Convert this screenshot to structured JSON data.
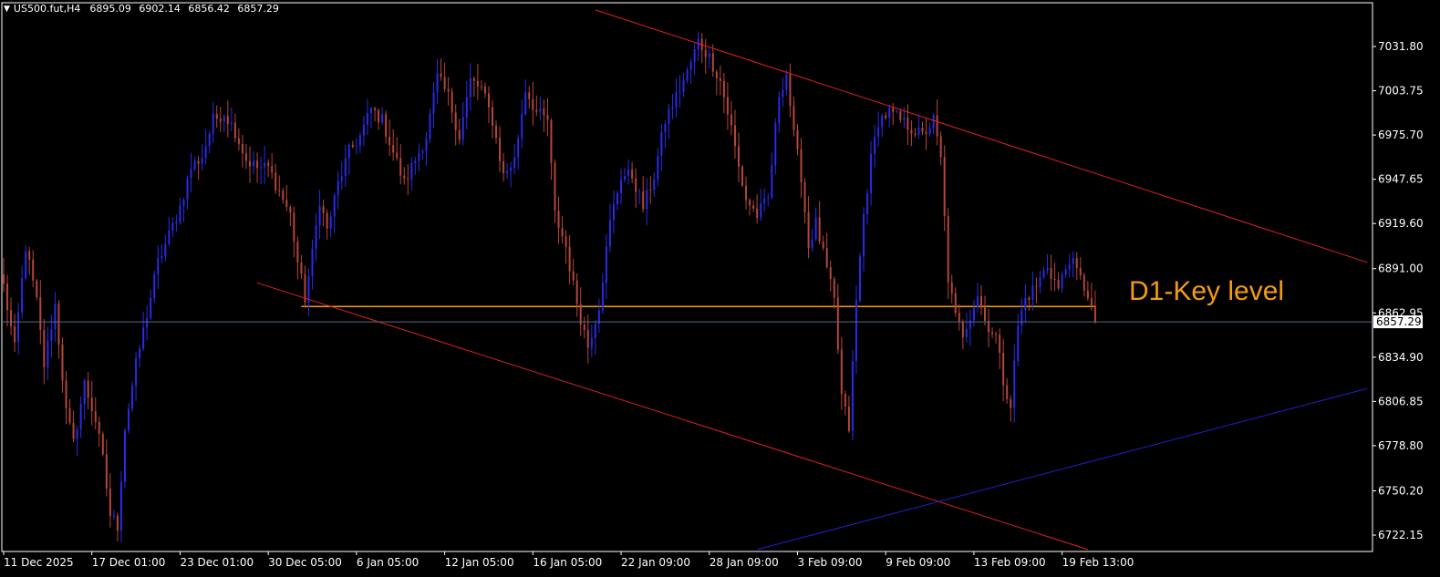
{
  "header": {
    "symbol": "US500.fut,H4",
    "open": "6895.09",
    "high": "6902.14",
    "low": "6856.42",
    "close": "6857.29"
  },
  "annotation": {
    "text": "D1-Key level",
    "color": "#f39c12"
  },
  "colors": {
    "background": "#000000",
    "frame": "#ffffff",
    "bull_candle": "#2a2ae8",
    "bear_candle": "#b5463a",
    "channel_line": "#e02020",
    "support_line": "#2020d0",
    "key_level": "#f39c12",
    "current_price_line": "#5a6b86"
  },
  "chart_data": {
    "type": "candlestick",
    "title": "US500.fut,H4",
    "ylim": [
      6710,
      7051
    ],
    "grid": false,
    "y_ticks": [
      "7031.80",
      "7003.75",
      "6975.70",
      "6947.65",
      "6919.60",
      "6891.00",
      "6862.95",
      "6834.90",
      "6806.85",
      "6778.80",
      "6750.20",
      "6722.15"
    ],
    "x_ticks": [
      {
        "label": "11 Dec 2025",
        "index": 0
      },
      {
        "label": "17 Dec 01:00",
        "index": 24
      },
      {
        "label": "23 Dec 01:00",
        "index": 48
      },
      {
        "label": "30 Dec 05:00",
        "index": 72
      },
      {
        "label": "6 Jan 05:00",
        "index": 96
      },
      {
        "label": "12 Jan 05:00",
        "index": 120
      },
      {
        "label": "16 Jan 05:00",
        "index": 144
      },
      {
        "label": "22 Jan 09:00",
        "index": 168
      },
      {
        "label": "28 Jan 09:00",
        "index": 192
      },
      {
        "label": "3 Feb 09:00",
        "index": 216
      },
      {
        "label": "9 Feb 09:00",
        "index": 240
      },
      {
        "label": "13 Feb 09:00",
        "index": 264
      },
      {
        "label": "19 Feb 13:00",
        "index": 288
      }
    ],
    "key_level": {
      "label": "D1-Key level",
      "price": 6867,
      "start_index": 81,
      "end_index": 297
    },
    "current_price": {
      "label": "6857.29",
      "value": 6857.29
    },
    "trendlines": [
      {
        "name": "upper-channel",
        "start": {
          "index": 161,
          "price": 7055
        },
        "end": {
          "index": 371,
          "price": 6895
        }
      },
      {
        "name": "lower-channel",
        "start": {
          "index": 69,
          "price": 6882
        },
        "end": {
          "index": 295,
          "price": 6713
        }
      },
      {
        "name": "blue-support",
        "start": {
          "index": 205,
          "price": 6713
        },
        "end": {
          "index": 371,
          "price": 6815
        }
      }
    ],
    "anchors": [
      [
        0,
        6880
      ],
      [
        3,
        6840
      ],
      [
        6,
        6905
      ],
      [
        9,
        6870
      ],
      [
        11,
        6830
      ],
      [
        14,
        6868
      ],
      [
        17,
        6800
      ],
      [
        19,
        6780
      ],
      [
        22,
        6818
      ],
      [
        25,
        6795
      ],
      [
        27,
        6770
      ],
      [
        29,
        6735
      ],
      [
        31,
        6728
      ],
      [
        33,
        6790
      ],
      [
        36,
        6830
      ],
      [
        39,
        6862
      ],
      [
        42,
        6895
      ],
      [
        45,
        6912
      ],
      [
        48,
        6930
      ],
      [
        51,
        6955
      ],
      [
        54,
        6962
      ],
      [
        57,
        6985
      ],
      [
        60,
        6990
      ],
      [
        63,
        6978
      ],
      [
        66,
        6960
      ],
      [
        69,
        6955
      ],
      [
        72,
        6955
      ],
      [
        75,
        6940
      ],
      [
        78,
        6925
      ],
      [
        80,
        6895
      ],
      [
        82,
        6872
      ],
      [
        84,
        6900
      ],
      [
        86,
        6935
      ],
      [
        88,
        6915
      ],
      [
        91,
        6945
      ],
      [
        94,
        6965
      ],
      [
        97,
        6975
      ],
      [
        100,
        6992
      ],
      [
        103,
        6985
      ],
      [
        106,
        6965
      ],
      [
        109,
        6945
      ],
      [
        112,
        6960
      ],
      [
        115,
        6975
      ],
      [
        118,
        7012
      ],
      [
        121,
        7000
      ],
      [
        124,
        6975
      ],
      [
        127,
        7010
      ],
      [
        130,
        7005
      ],
      [
        133,
        6985
      ],
      [
        136,
        6950
      ],
      [
        139,
        6960
      ],
      [
        142,
        7005
      ],
      [
        145,
        6990
      ],
      [
        148,
        6985
      ],
      [
        150,
        6925
      ],
      [
        153,
        6905
      ],
      [
        155,
        6880
      ],
      [
        157,
        6860
      ],
      [
        159,
        6842
      ],
      [
        162,
        6868
      ],
      [
        165,
        6920
      ],
      [
        168,
        6950
      ],
      [
        171,
        6950
      ],
      [
        174,
        6930
      ],
      [
        177,
        6950
      ],
      [
        180,
        6985
      ],
      [
        183,
        7000
      ],
      [
        186,
        7015
      ],
      [
        189,
        7035
      ],
      [
        192,
        7025
      ],
      [
        195,
        7010
      ],
      [
        198,
        6980
      ],
      [
        200,
        6955
      ],
      [
        202,
        6935
      ],
      [
        205,
        6925
      ],
      [
        208,
        6935
      ],
      [
        211,
        7002
      ],
      [
        213,
        7015
      ],
      [
        215,
        6975
      ],
      [
        217,
        6950
      ],
      [
        219,
        6905
      ],
      [
        221,
        6920
      ],
      [
        224,
        6890
      ],
      [
        226,
        6870
      ],
      [
        228,
        6810
      ],
      [
        230,
        6790
      ],
      [
        232,
        6870
      ],
      [
        234,
        6925
      ],
      [
        236,
        6960
      ],
      [
        238,
        6985
      ],
      [
        241,
        6990
      ],
      [
        244,
        6985
      ],
      [
        247,
        6980
      ],
      [
        250,
        6975
      ],
      [
        253,
        6985
      ],
      [
        255,
        6960
      ],
      [
        257,
        6885
      ],
      [
        259,
        6860
      ],
      [
        261,
        6850
      ],
      [
        263,
        6862
      ],
      [
        265,
        6875
      ],
      [
        267,
        6858
      ],
      [
        270,
        6848
      ],
      [
        272,
        6820
      ],
      [
        274,
        6805
      ],
      [
        276,
        6855
      ],
      [
        278,
        6872
      ],
      [
        281,
        6880
      ],
      [
        284,
        6893
      ],
      [
        287,
        6878
      ],
      [
        290,
        6898
      ],
      [
        293,
        6884
      ],
      [
        295,
        6875
      ],
      [
        297,
        6857.29
      ]
    ]
  }
}
